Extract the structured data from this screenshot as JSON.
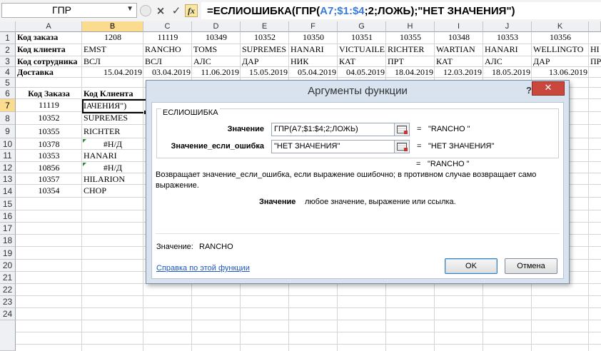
{
  "formula_bar": {
    "name_box": "ГПР",
    "formula_prefix": "=ЕСЛИОШИБКА(ГПР(",
    "formula_range": "A7;$1:$4",
    "formula_suffix": ";2;ЛОЖЬ);\"НЕТ ЗНАЧЕНИЯ\")",
    "fx_label": "fx",
    "cancel_icon": "×",
    "enter_icon": "✓"
  },
  "columns": [
    "A",
    "B",
    "C",
    "D",
    "E",
    "F",
    "G",
    "H",
    "I",
    "J",
    "K",
    ""
  ],
  "rows": [
    "1",
    "2",
    "3",
    "4",
    "5",
    "6",
    "7",
    "8",
    "9",
    "10",
    "11",
    "12",
    "13",
    "14",
    "15",
    "16",
    "17",
    "18",
    "19",
    "20",
    "21",
    "22",
    "23",
    "24"
  ],
  "sheet": {
    "row1": {
      "label": "Код заказа",
      "values": [
        "1208",
        "11119",
        "10349",
        "10352",
        "10350",
        "10351",
        "10355",
        "10348",
        "10353",
        "10356"
      ]
    },
    "row2": {
      "label": "Код клиента",
      "values": [
        "EMST",
        "RANCHO",
        "TOMS",
        "SUPREMES",
        "HANARI",
        "VICTUAILE",
        "RICHTER",
        "WARTIAN",
        "HANARI",
        "WELLINGTO",
        "HI"
      ]
    },
    "row3": {
      "label": "Код сотрудника",
      "values": [
        "ВСЛ",
        "ВСЛ",
        "АЛС",
        "ДАР",
        "НИК",
        "КАТ",
        "ПРТ",
        "КАТ",
        "АЛС",
        "ДАР",
        "ПР"
      ]
    },
    "row4": {
      "label": "Доставка",
      "values": [
        "15.04.2019",
        "03.04.2019",
        "11.06.2019",
        "15.05.2019",
        "05.04.2019",
        "04.05.2019",
        "18.04.2019",
        "12.03.2019",
        "18.05.2019",
        "13.06.2019"
      ]
    },
    "header6": {
      "a": "Код Заказа",
      "b": "Код Клиента"
    },
    "list": [
      {
        "a": "11119",
        "b": "IАЧЕНИЯ\")"
      },
      {
        "a": "10352",
        "b": "SUPREMES"
      },
      {
        "a": "10355",
        "b": "RICHTER"
      },
      {
        "a": "10378",
        "b": "#Н/Д"
      },
      {
        "a": "10353",
        "b": "HANARI"
      },
      {
        "a": "10856",
        "b": "#Н/Д"
      },
      {
        "a": "10357",
        "b": "HILARION"
      },
      {
        "a": "10354",
        "b": "CHOP"
      }
    ]
  },
  "dialog": {
    "title": "Аргументы функции",
    "help_mark": "?",
    "close_icon": "✕",
    "function_name": "ЕСЛИОШИБКА",
    "arg1_label": "Значение",
    "arg1_value": "ГПР(A7;$1:$4;2;ЛОЖЬ)",
    "arg1_result": "\"RANCHO \"",
    "arg2_label": "Значение_если_ошибка",
    "arg2_value": "\"НЕТ ЗНАЧЕНИЯ\"",
    "arg2_result": "\"НЕТ ЗНАЧЕНИЯ\"",
    "eq": "=",
    "total_result": "\"RANCHO \"",
    "description": "Возвращает значение_если_ошибка, если выражение ошибочно; в противном случае возвращает само выражение.",
    "arg_desc_name": "Значение",
    "arg_desc_text": "любое значение, выражение или ссылка.",
    "value_label": "Значение:",
    "value_result": "RANCHO",
    "help_link": "Справка по этой функции",
    "ok_label": "OK",
    "cancel_label": "Отмена"
  }
}
